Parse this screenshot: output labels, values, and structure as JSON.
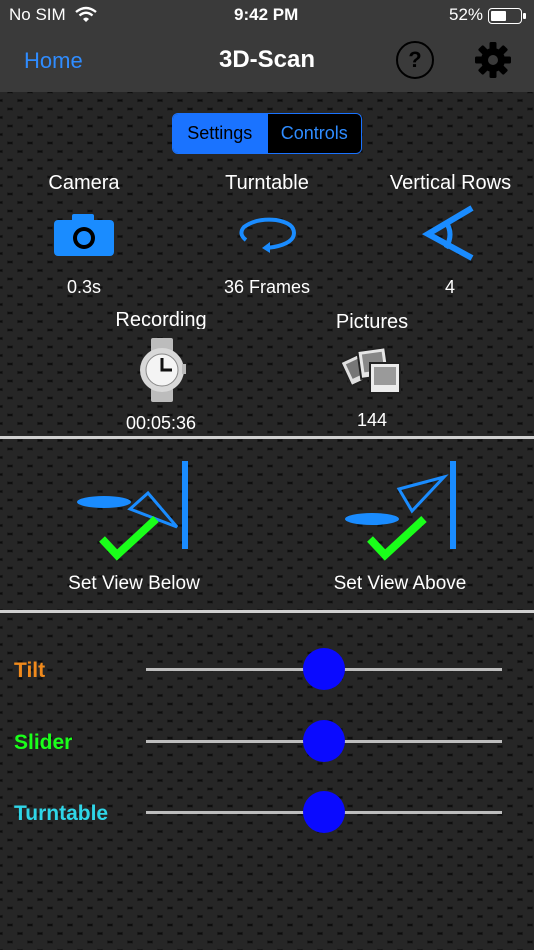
{
  "status": {
    "carrier": "No SIM",
    "time": "9:42 PM",
    "battery": "52%"
  },
  "nav": {
    "home": "Home",
    "title": "3D-Scan",
    "help_icon": "?"
  },
  "segment": {
    "settings": "Settings",
    "controls": "Controls",
    "selected": "Settings"
  },
  "stats": {
    "camera": {
      "label": "Camera",
      "value": "0.3s"
    },
    "turntable": {
      "label": "Turntable",
      "value": "36 Frames"
    },
    "vertical_rows": {
      "label": "Vertical Rows",
      "value": "4"
    },
    "recording": {
      "label": "Recording",
      "value": "00:05:36"
    },
    "pictures": {
      "label": "Pictures",
      "value": "144"
    }
  },
  "views": {
    "below": "Set View Below",
    "above": "Set View Above"
  },
  "sliders": [
    {
      "label": "Tilt",
      "color": "#f08a1c",
      "value": 0.5
    },
    {
      "label": "Slider",
      "color": "#1aff1a",
      "value": 0.5
    },
    {
      "label": "Turntable",
      "color": "#2fd6e8",
      "value": 0.5
    }
  ],
  "colors": {
    "accent": "#1a73ff",
    "knob": "#0a0aff",
    "check": "#1aff1a"
  }
}
